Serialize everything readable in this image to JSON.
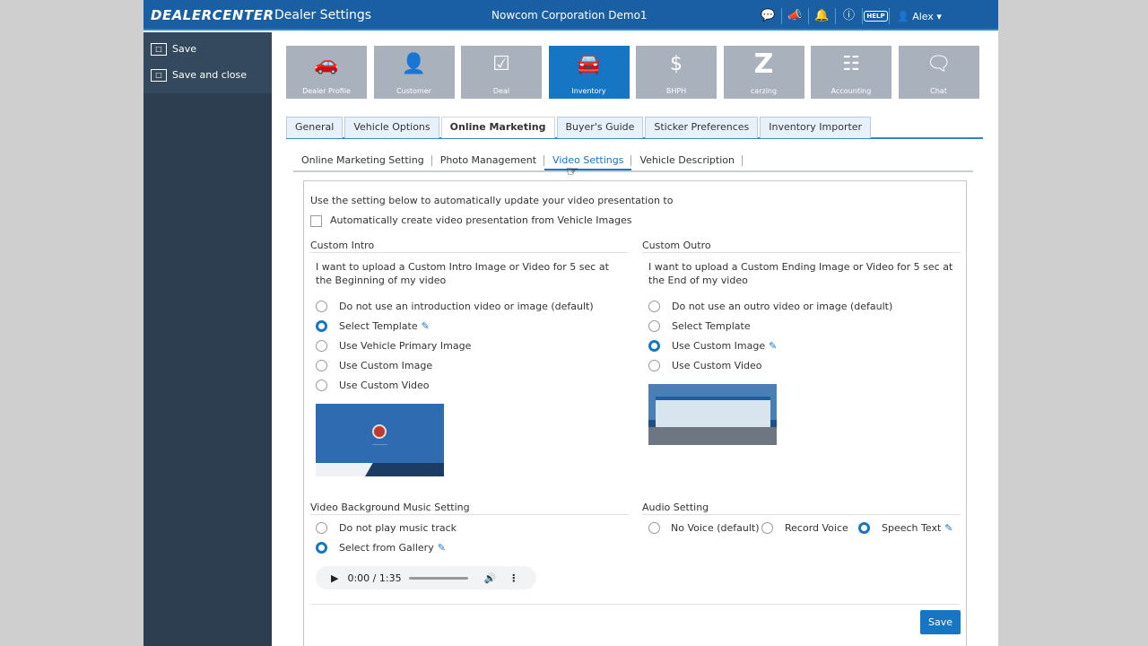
{
  "header": {
    "brand": "DEALERCENTER",
    "page": "Dealer Settings",
    "company": "Nowcom Corporation Demo1",
    "icons": [
      "chat-icon",
      "megaphone-icon",
      "bell-icon",
      "question-icon",
      "help-icon"
    ],
    "help_label": "HELP",
    "user": "Alex"
  },
  "sidebar": {
    "save_label": "Save",
    "save_close_label": "Save and close"
  },
  "tiles": [
    {
      "label": "Dealer Profile",
      "icon": "dealer-profile-icon"
    },
    {
      "label": "Customer",
      "icon": "customer-icon"
    },
    {
      "label": "Deal",
      "icon": "deal-icon"
    },
    {
      "label": "Inventory",
      "icon": "car-icon",
      "active": true
    },
    {
      "label": "BHPH",
      "icon": "map-pin-dollar-icon"
    },
    {
      "label": "carzing",
      "icon": "carzing-icon"
    },
    {
      "label": "Accounting",
      "icon": "abacus-icon"
    },
    {
      "label": "Chat",
      "icon": "chat-bubble-icon"
    }
  ],
  "tabs": [
    {
      "label": "General"
    },
    {
      "label": "Vehicle Options"
    },
    {
      "label": "Online Marketing",
      "active": true
    },
    {
      "label": "Buyer's Guide"
    },
    {
      "label": "Sticker Preferences"
    },
    {
      "label": "Inventory Importer"
    }
  ],
  "subtabs": [
    {
      "label": "Online Marketing Setting"
    },
    {
      "label": "Photo Management"
    },
    {
      "label": "Video Settings",
      "active": true
    },
    {
      "label": "Vehicle Description"
    }
  ],
  "panel": {
    "intro_text": "Use the setting below to automatically update your video presentation to",
    "auto_create_label": "Automatically create video presentation from Vehicle Images",
    "custom_intro": {
      "title": "Custom Intro",
      "description": "I want to upload a Custom Intro Image or Video for 5 sec at the Beginning of my video",
      "options": [
        {
          "label": "Do not use an introduction video or image (default)",
          "selected": false
        },
        {
          "label": "Select Template",
          "selected": true,
          "editable": true
        },
        {
          "label": "Use Vehicle Primary Image",
          "selected": false
        },
        {
          "label": "Use Custom Image",
          "selected": false
        },
        {
          "label": "Use Custom Video",
          "selected": false
        }
      ]
    },
    "custom_outro": {
      "title": "Custom Outro",
      "description": "I want to upload a Custom Ending Image or Video for 5 sec at the End of my video",
      "options": [
        {
          "label": "Do not use an outro video or image (default)",
          "selected": false
        },
        {
          "label": "Select Template",
          "selected": false
        },
        {
          "label": "Use Custom Image",
          "selected": true,
          "editable": true
        },
        {
          "label": "Use Custom Video",
          "selected": false
        }
      ]
    },
    "music": {
      "title": "Video Background Music Setting",
      "options": [
        {
          "label": "Do not play music track",
          "selected": false
        },
        {
          "label": "Select from Gallery",
          "selected": true,
          "editable": true
        }
      ],
      "player_time": "0:00 / 1:35"
    },
    "audio": {
      "title": "Audio Setting",
      "options": [
        {
          "label": "No Voice (default)",
          "selected": false
        },
        {
          "label": "Record Voice",
          "selected": false
        },
        {
          "label": "Speech Text",
          "selected": true,
          "editable": true
        }
      ]
    },
    "save_label": "Save"
  },
  "colors": {
    "accent": "#1676c4",
    "header": "#1a5fa3",
    "sidebar": "#2c3e50",
    "tile_inactive": "#a9b1bd"
  }
}
